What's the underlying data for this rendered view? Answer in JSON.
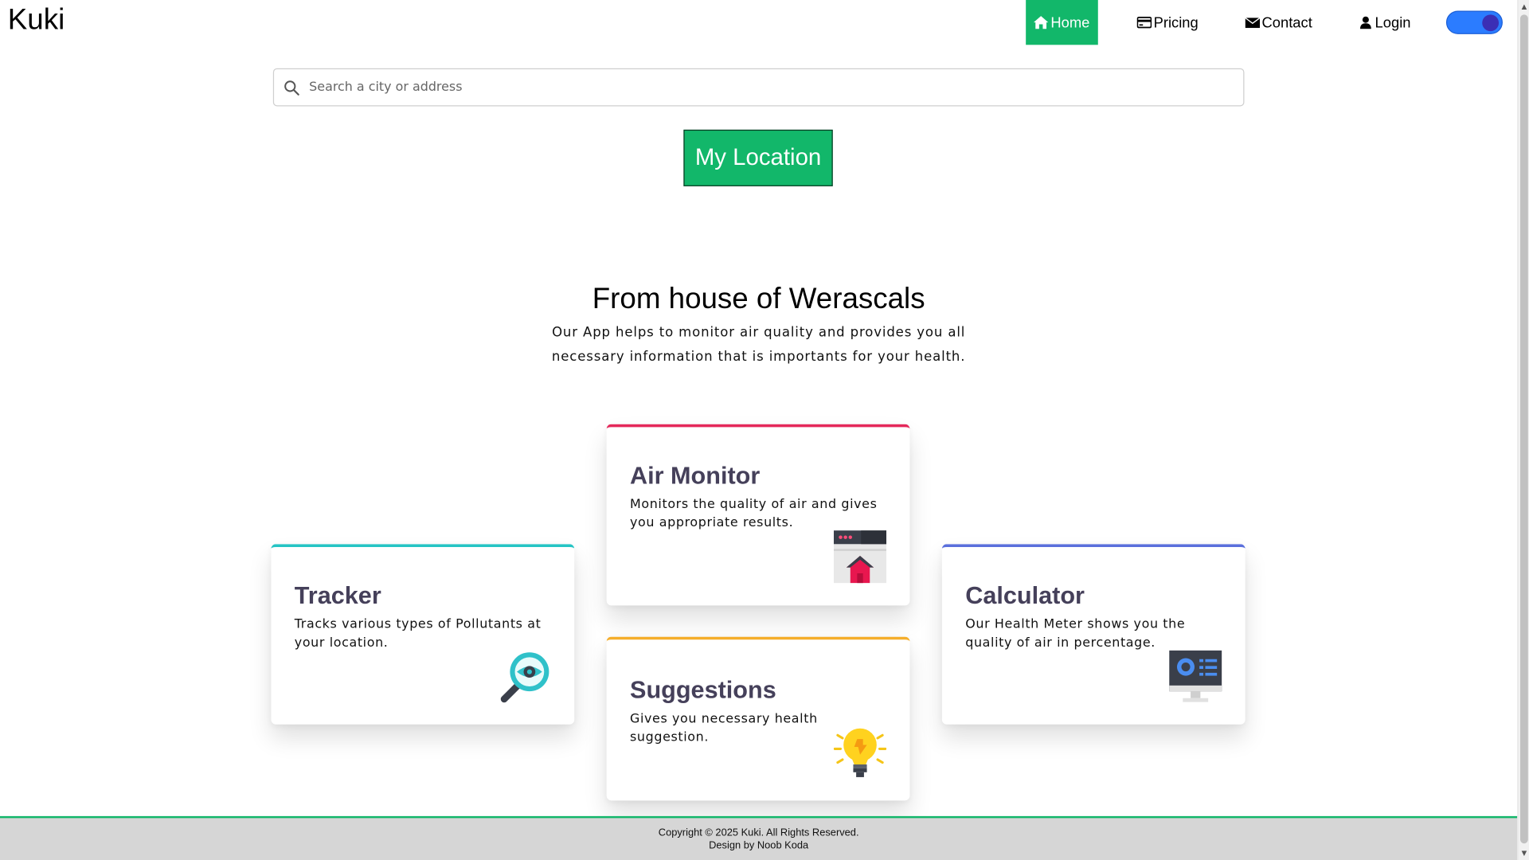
{
  "header": {
    "brand": "Kuki",
    "nav": {
      "home": "Home",
      "pricing": "Pricing",
      "contact": "Contact",
      "login": "Login"
    }
  },
  "search": {
    "placeholder": "Search a city or address",
    "value": ""
  },
  "location_button": "My Location",
  "hero": {
    "title": "From house of Werascals",
    "description": "Our App helps to monitor air quality and provides you all necessary information that is importants for your health."
  },
  "cards": {
    "air_monitor": {
      "title": "Air Monitor",
      "description": "Monitors the quality of air and gives you appropriate results.",
      "accent": "#e4285a",
      "icon": "house-window-icon"
    },
    "tracker": {
      "title": "Tracker",
      "description": "Tracks various types of Pollutants at your location.",
      "accent": "#25c4c4",
      "icon": "magnifier-eye-icon"
    },
    "calculator": {
      "title": "Calculator",
      "description": "Our Health Meter shows you the quality of air in percentage.",
      "accent": "#5a6fdc",
      "icon": "monitor-dashboard-icon"
    },
    "suggestions": {
      "title": "Suggestions",
      "description": "Gives you necessary health suggestion.",
      "accent": "#f5ae2b",
      "icon": "lightbulb-icon"
    }
  },
  "footer": {
    "copyright": "Copyright © 2025 Kuki. All Rights Reserved.",
    "credit": "Design by Noob Koda"
  },
  "colors": {
    "primary": "#12b76a",
    "toggle": "#2b7cff"
  }
}
